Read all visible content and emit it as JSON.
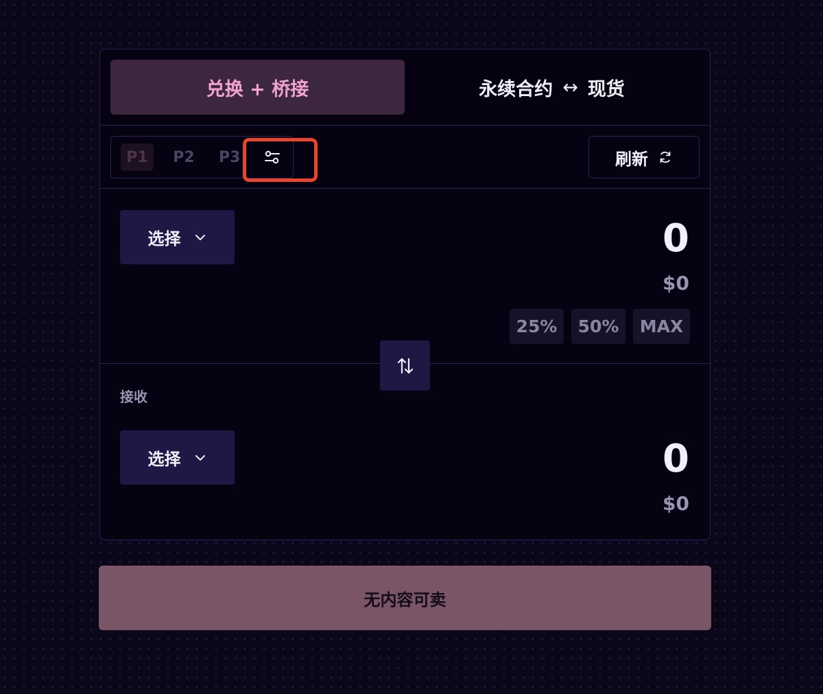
{
  "tabs": {
    "swap_bridge": "兑换 + 桥接",
    "perp": "永续合约",
    "perp_arrow": "↔",
    "spot": "现货"
  },
  "presets": {
    "p1": "P1",
    "p2": "P2",
    "p3": "P3"
  },
  "refresh_label": "刷新",
  "sell_panel": {
    "select_label": "选择",
    "amount": "0",
    "usd_value": "$0",
    "pct_buttons": [
      "25%",
      "50%",
      "MAX"
    ]
  },
  "receive_panel": {
    "label": "接收",
    "select_label": "选择",
    "amount": "0",
    "usd_value": "$0"
  },
  "submit_label": "无内容可卖",
  "colors": {
    "accent_pink": "#f0a3cc",
    "highlight_box": "#e8442e",
    "submit_bg": "#7a5566"
  },
  "icons": {
    "settings": "sliders-icon",
    "refresh": "refresh-icon",
    "dropdown": "chevron-down-icon",
    "swap": "swap-vertical-icon"
  }
}
